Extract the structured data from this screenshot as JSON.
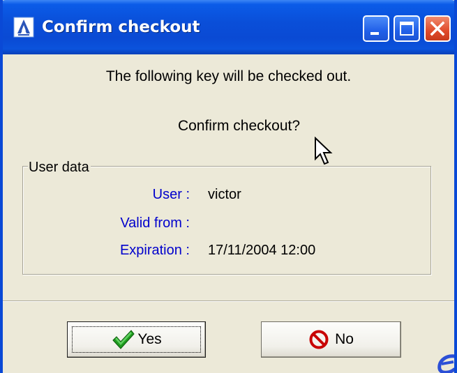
{
  "window": {
    "title": "Confirm checkout",
    "controls": [
      "minimize-icon",
      "maximize-icon",
      "close-icon"
    ]
  },
  "message": {
    "line1": "The following key will be checked out.",
    "line2": "Confirm checkout?"
  },
  "user_data": {
    "group_label": "User data",
    "fields": [
      {
        "label": "User :",
        "value": "victor"
      },
      {
        "label": "Valid from :",
        "value": ""
      },
      {
        "label": "Expiration :",
        "value": "17/11/2004 12:00"
      }
    ]
  },
  "buttons": {
    "yes": {
      "label": "Yes",
      "icon": "checkmark-icon"
    },
    "no": {
      "label": "No",
      "icon": "no-entry-icon"
    }
  },
  "colors": {
    "titlebar": "#0a4fd9",
    "field_label": "#0000cc",
    "close_button": "#e04a2a",
    "window_body": "#ece9d8"
  }
}
